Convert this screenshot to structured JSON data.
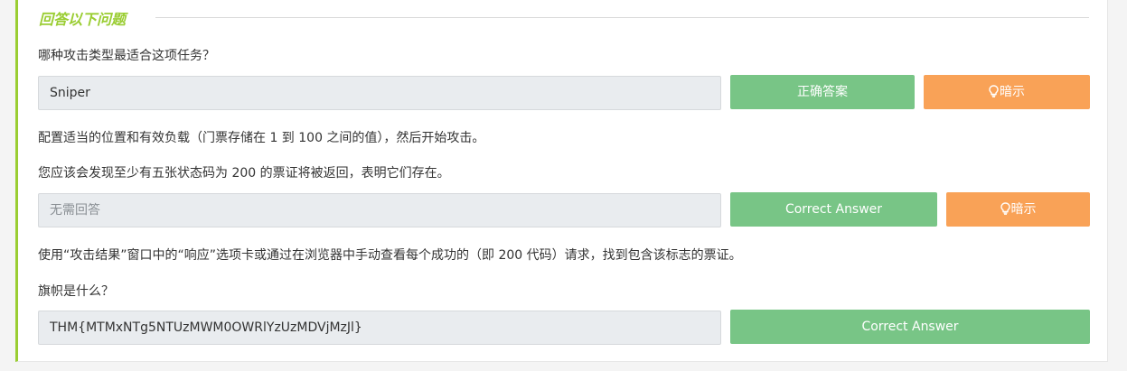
{
  "section": {
    "title": "回答以下问题"
  },
  "q1": {
    "question": "哪种攻击类型最适合这项任务？",
    "answer": "Sniper",
    "submit_label": "正确答案",
    "hint_label": "暗示"
  },
  "q2": {
    "instruction": "配置适当的位置和有效负载（门票存储在 1 到 100 之间的值），然后开始攻击。",
    "question": "您应该会发现至少有五张状态码为 200 的票证将被返回，表明它们存在。",
    "answer_placeholder": "无需回答",
    "submit_label": "Correct Answer",
    "hint_label": "暗示"
  },
  "q3": {
    "instruction": "使用“攻击结果”窗口中的“响应”选项卡或通过在浏览器中手动查看每个成功的（即 200 代码）请求，找到包含该标志的票证。",
    "question": "旗帜是什么？",
    "answer": "THM{MTMxNTg5NTUzMWM0OWRlYzUzMDVjMzJl}",
    "submit_label": "Correct Answer"
  },
  "colors": {
    "accent": "#9acd32",
    "correct": "#78c586",
    "hint": "#f9a257",
    "field_bg": "#e9ecef"
  },
  "icons": {
    "hint": "lightbulb-icon"
  }
}
